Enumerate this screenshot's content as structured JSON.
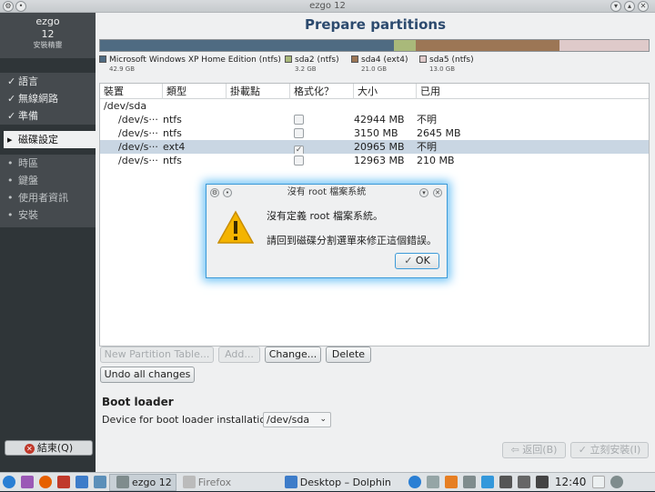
{
  "window": {
    "title": "ezgo 12"
  },
  "sidebar": {
    "brand": {
      "name": "ezgo",
      "version": "12",
      "subtitle": "安裝精靈"
    },
    "done_steps": [
      {
        "label": "語言",
        "mark": "✓"
      },
      {
        "label": "無線網路",
        "mark": "✓"
      },
      {
        "label": "準備",
        "mark": "✓"
      }
    ],
    "current_step": {
      "label": "磁碟設定",
      "mark": "▸"
    },
    "later_steps": [
      {
        "label": "時區",
        "mark": "•"
      },
      {
        "label": "鍵盤",
        "mark": "•"
      },
      {
        "label": "使用者資訊",
        "mark": "•"
      },
      {
        "label": "安裝",
        "mark": "•"
      }
    ],
    "quit_label": "結束(Q)"
  },
  "main": {
    "title": "Prepare partitions",
    "partition_bar": [
      {
        "name": "Microsoft Windows XP Home Edition (ntfs)",
        "size": "42.9 GB",
        "color": "#4f6b82",
        "fraction": 0.536
      },
      {
        "name": "sda2 (ntfs)",
        "size": "3.2 GB",
        "color": "#a9b97a",
        "fraction": 0.04
      },
      {
        "name": "sda4 (ext4)",
        "size": "21.0 GB",
        "color": "#9c7655",
        "fraction": 0.262
      },
      {
        "name": "sda5 (ntfs)",
        "size": "13.0 GB",
        "color": "#dfcaca",
        "fraction": 0.162
      }
    ],
    "table": {
      "columns": [
        "裝置",
        "類型",
        "掛載點",
        "格式化？",
        "大小",
        "已用"
      ],
      "rows": [
        {
          "device": "/dev/sda",
          "type": "",
          "mount": "",
          "format": "",
          "size": "",
          "used": "",
          "indent": 0,
          "checkbox": false
        },
        {
          "device": "/dev/s···",
          "type": "ntfs",
          "mount": "",
          "format": "",
          "size": "42944 MB",
          "used": "不明",
          "indent": 1,
          "checkbox": true
        },
        {
          "device": "/dev/s···",
          "type": "ntfs",
          "mount": "",
          "format": "",
          "size": "3150 MB",
          "used": "2645 MB",
          "indent": 1,
          "checkbox": true
        },
        {
          "device": "/dev/s···",
          "type": "ext4",
          "mount": "",
          "format": "✓",
          "size": "20965 MB",
          "used": "不明",
          "indent": 1,
          "checkbox": true,
          "selected": true
        },
        {
          "device": "/dev/s···",
          "type": "ntfs",
          "mount": "",
          "format": "",
          "size": "12963 MB",
          "used": "210 MB",
          "indent": 1,
          "checkbox": true
        }
      ]
    },
    "buttons": {
      "new_table": "New Partition Table...",
      "add": "Add...",
      "change": "Change...",
      "delete": "Delete",
      "undo": "Undo all changes"
    },
    "boot": {
      "title": "Boot loader",
      "label": "Device for boot loader installation:",
      "device": "/dev/sda"
    },
    "nav": {
      "back": "返回(B)",
      "next": "立刻安裝(I)"
    }
  },
  "dialog": {
    "title": "沒有 root 檔案系統",
    "message": "沒有定義 root 檔案系統。",
    "detail": "請回到磁碟分割選單來修正這個錯誤。",
    "ok": "OK"
  },
  "taskbar": {
    "tasks": [
      "ezgo 12",
      "Firefox",
      "Desktop – Dolphin"
    ],
    "clock": "12:40"
  }
}
